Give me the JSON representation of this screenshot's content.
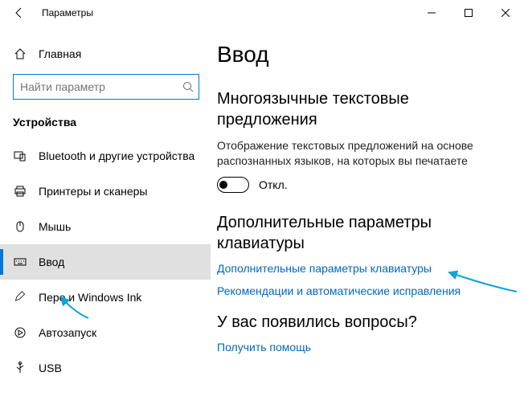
{
  "window": {
    "title": "Параметры"
  },
  "sidebar": {
    "home": "Главная",
    "search_placeholder": "Найти параметр",
    "section": "Устройства",
    "items": [
      {
        "label": "Bluetooth и другие устройства"
      },
      {
        "label": "Принтеры и сканеры"
      },
      {
        "label": "Мышь"
      },
      {
        "label": "Ввод"
      },
      {
        "label": "Перо и Windows Ink"
      },
      {
        "label": "Автозапуск"
      },
      {
        "label": "USB"
      }
    ]
  },
  "content": {
    "page_title": "Ввод",
    "section1_title": "Многоязычные текстовые предложения",
    "section1_desc": "Отображение текстовых предложений на основе распознанных языков, на которых вы печатаете",
    "toggle_state": "Откл.",
    "section2_title": "Дополнительные параметры клавиатуры",
    "link1": "Дополнительные параметры клавиатуры",
    "link2": "Рекомендации и автоматические исправления",
    "section3_title": "У вас появились вопросы?",
    "link3": "Получить помощь"
  }
}
